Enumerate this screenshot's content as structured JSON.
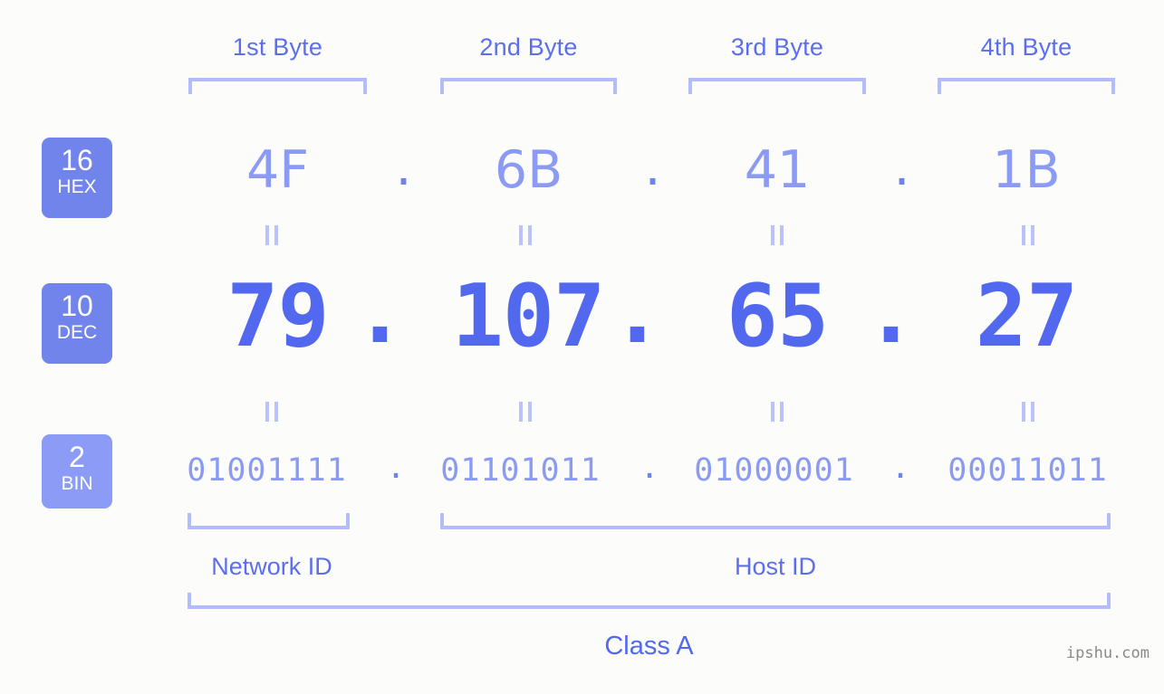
{
  "headers": [
    {
      "label": "1st Byte"
    },
    {
      "label": "2nd Byte"
    },
    {
      "label": "3rd Byte"
    },
    {
      "label": "4th Byte"
    }
  ],
  "bases": [
    {
      "number": "16",
      "name": "HEX"
    },
    {
      "number": "10",
      "name": "DEC"
    },
    {
      "number": "2",
      "name": "BIN"
    }
  ],
  "separator": ".",
  "rows": {
    "hex": {
      "base_number": "16",
      "base_name": "HEX",
      "values": [
        "4F",
        "6B",
        "41",
        "1B"
      ]
    },
    "dec": {
      "base_number": "10",
      "base_name": "DEC",
      "values": [
        "79",
        "107",
        "65",
        "27"
      ]
    },
    "bin": {
      "base_number": "2",
      "base_name": "BIN",
      "values": [
        "01001111",
        "01101011",
        "01000001",
        "00011011"
      ]
    }
  },
  "segments": [
    {
      "label": "Network ID"
    },
    {
      "label": "Host ID"
    }
  ],
  "class": {
    "label": "Class A"
  },
  "watermark": {
    "text": "ipshu.com"
  },
  "colors": {
    "background": "#fcfdfa",
    "accent_strong": "#5168ef",
    "accent_header": "#5b6ef0",
    "accent_light": "#8b9bf4",
    "bracket": "#b4bdfb",
    "badge": "#7184ec",
    "badge_bin": "#8c9cf6",
    "watermark": "#8a8a8a"
  }
}
